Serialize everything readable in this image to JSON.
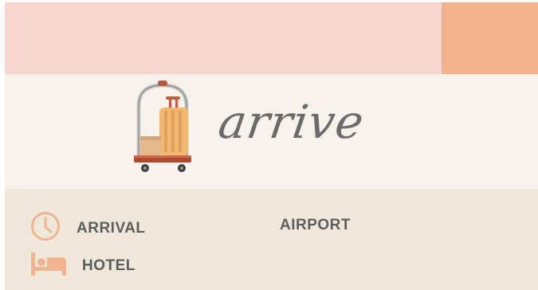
{
  "header": {
    "title": "arrive"
  },
  "details": {
    "arrival_label": "ARRIVAL",
    "airport_label": "AIRPORT",
    "hotel_label": "HOTEL"
  },
  "icons": {
    "hero": "luggage-cart-icon",
    "arrival": "clock-icon",
    "hotel": "bed-icon"
  },
  "colors": {
    "banner": "#f5d5cd",
    "banner_accent": "#f1b28c",
    "hero_bg": "#f7f3ec",
    "details_bg": "#efe8da",
    "icon_accent": "#f0b490",
    "text": "#5d5d5d"
  }
}
